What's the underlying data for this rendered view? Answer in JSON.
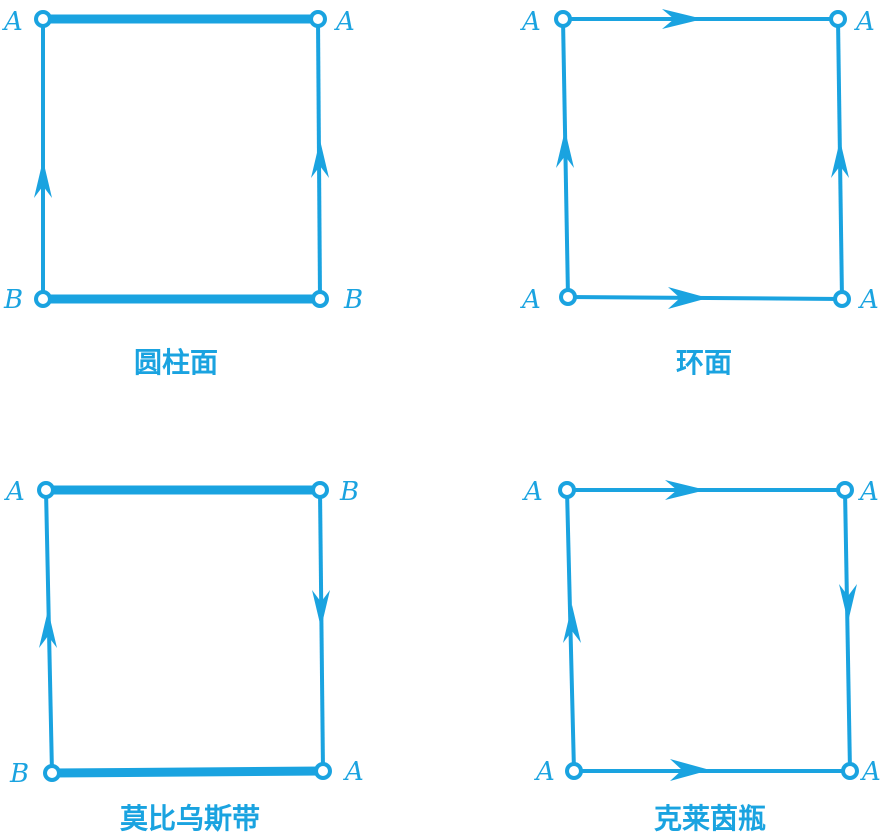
{
  "colors": {
    "stroke": "#1aa3e0"
  },
  "panels": [
    {
      "caption": "圆柱面",
      "labels": {
        "tl": "A",
        "tr": "A",
        "bl": "B",
        "br": "B"
      },
      "edges": {
        "top": "thick",
        "bottom": "thick",
        "left": "up",
        "right": "up"
      }
    },
    {
      "caption": "环面",
      "labels": {
        "tl": "A",
        "tr": "A",
        "bl": "A",
        "br": "A"
      },
      "edges": {
        "top": "right",
        "bottom": "right",
        "left": "up",
        "right": "up"
      }
    },
    {
      "caption": "莫比乌斯带",
      "labels": {
        "tl": "A",
        "tr": "B",
        "bl": "B",
        "br": "A"
      },
      "edges": {
        "top": "thick",
        "bottom": "thick",
        "left": "up",
        "right": "down"
      }
    },
    {
      "caption": "克莱茵瓶",
      "labels": {
        "tl": "A",
        "tr": "A",
        "bl": "A",
        "br": "A"
      },
      "edges": {
        "top": "right",
        "bottom": "right",
        "left": "up",
        "right": "down"
      }
    }
  ]
}
